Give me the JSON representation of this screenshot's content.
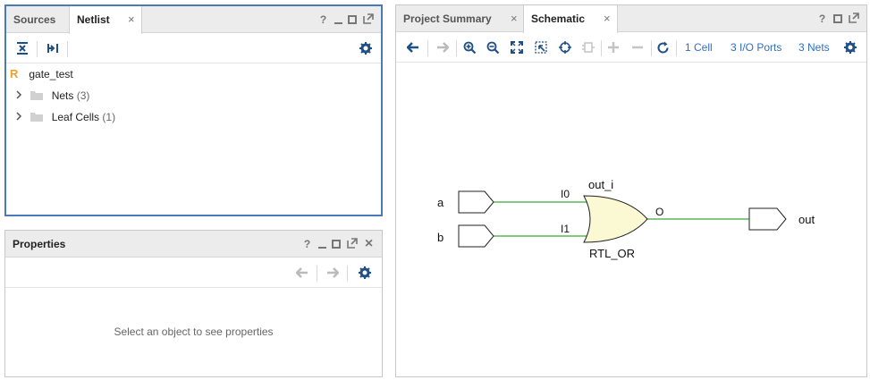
{
  "netlist_panel": {
    "tabs": [
      {
        "label": "Sources"
      },
      {
        "label": "Netlist",
        "close": "×"
      }
    ],
    "window_controls": {
      "help": "?"
    },
    "tree": {
      "root": {
        "badge": "R",
        "label": "gate_test"
      },
      "items": [
        {
          "label": "Nets",
          "count": "(3)"
        },
        {
          "label": "Leaf Cells",
          "count": "(1)"
        }
      ]
    }
  },
  "properties_panel": {
    "title": "Properties",
    "window_controls": {
      "help": "?",
      "close": "×"
    },
    "empty_message": "Select an object to see properties"
  },
  "schematic_panel": {
    "tabs": [
      {
        "label": "Project Summary",
        "close": "×"
      },
      {
        "label": "Schematic",
        "close": "×"
      }
    ],
    "window_controls": {
      "help": "?"
    },
    "toolbar": {
      "cells_link": "1 Cell",
      "ports_link": "3 I/O Ports",
      "nets_link": "3 Nets"
    },
    "diagram": {
      "input_ports": [
        {
          "name": "a"
        },
        {
          "name": "b"
        }
      ],
      "output_port": {
        "name": "out"
      },
      "gate": {
        "instance_name": "out_i",
        "type_label": "RTL_OR",
        "pin_in0": "I0",
        "pin_in1": "I1",
        "pin_out": "O"
      }
    }
  },
  "colors": {
    "accent_blue": "#4a7ab8",
    "link_blue": "#2f6fc4",
    "wire_green": "#3aa83a",
    "gate_fill": "#fbf9d3",
    "root_badge_orange": "#f0a030",
    "icon_blue": "#1f4f86"
  },
  "icons": [
    "collapse-all-icon",
    "expand-all-icon",
    "settings-icon",
    "back-icon",
    "forward-icon",
    "zoom-in-icon",
    "zoom-out-icon",
    "zoom-fit-icon",
    "zoom-area-icon",
    "select-icon",
    "cell-icon",
    "add-icon",
    "remove-icon",
    "refresh-icon",
    "folder-icon",
    "chevron-right-icon"
  ]
}
